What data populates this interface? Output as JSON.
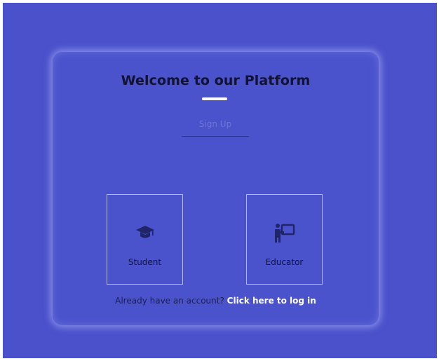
{
  "page": {
    "title": "Welcome to our Platform",
    "signup_tab": "Sign Up"
  },
  "roles": [
    {
      "label": "Student",
      "icon": "graduation-cap-icon"
    },
    {
      "label": "Educator",
      "icon": "teacher-board-icon"
    }
  ],
  "footer": {
    "prompt": "Already have an account?",
    "login_link": "Click here to log in"
  },
  "colors": {
    "background": "#4a51cb",
    "title": "#111330",
    "accent": "#ffffff",
    "icon": "#1f2568"
  }
}
